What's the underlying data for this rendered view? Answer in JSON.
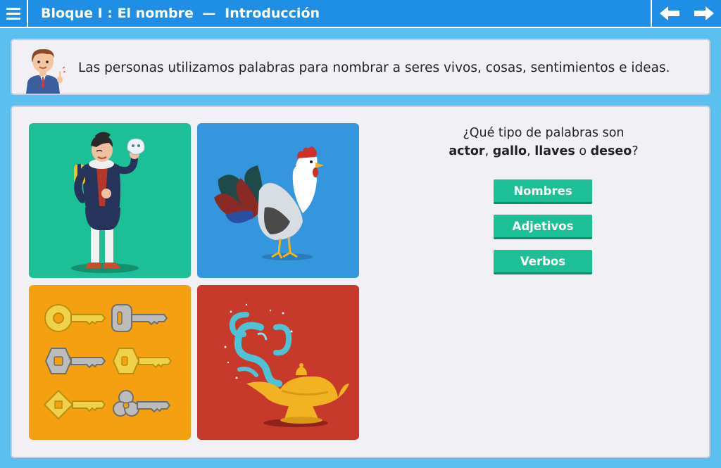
{
  "header": {
    "block": "Bloque I : El nombre",
    "separator": "—",
    "section": "Introducción"
  },
  "intro": {
    "text": "Las personas utilizamos palabras para nombrar a seres vivos, cosas, sentimientos e ideas."
  },
  "question": {
    "prefix": "¿Qué tipo de palabras son",
    "words": [
      "actor",
      "gallo",
      "llaves",
      "deseo"
    ],
    "comma": ",",
    "connector": "o",
    "suffix": "?"
  },
  "options": [
    {
      "label": "Nombres"
    },
    {
      "label": "Adjetivos"
    },
    {
      "label": "Verbos"
    }
  ],
  "images": [
    {
      "name": "actor",
      "icon": "actor-illustration",
      "bg": "#1cbf96"
    },
    {
      "name": "gallo",
      "icon": "rooster-illustration",
      "bg": "#3497dd"
    },
    {
      "name": "llaves",
      "icon": "keys-illustration",
      "bg": "#f5a011"
    },
    {
      "name": "deseo",
      "icon": "magic-lamp-illustration",
      "bg": "#c7392b"
    }
  ],
  "colors": {
    "topbar": "#1f8fe5",
    "page_bg": "#5bc0f0",
    "panel": "#f1f1f5",
    "button": "#1cbf96"
  }
}
